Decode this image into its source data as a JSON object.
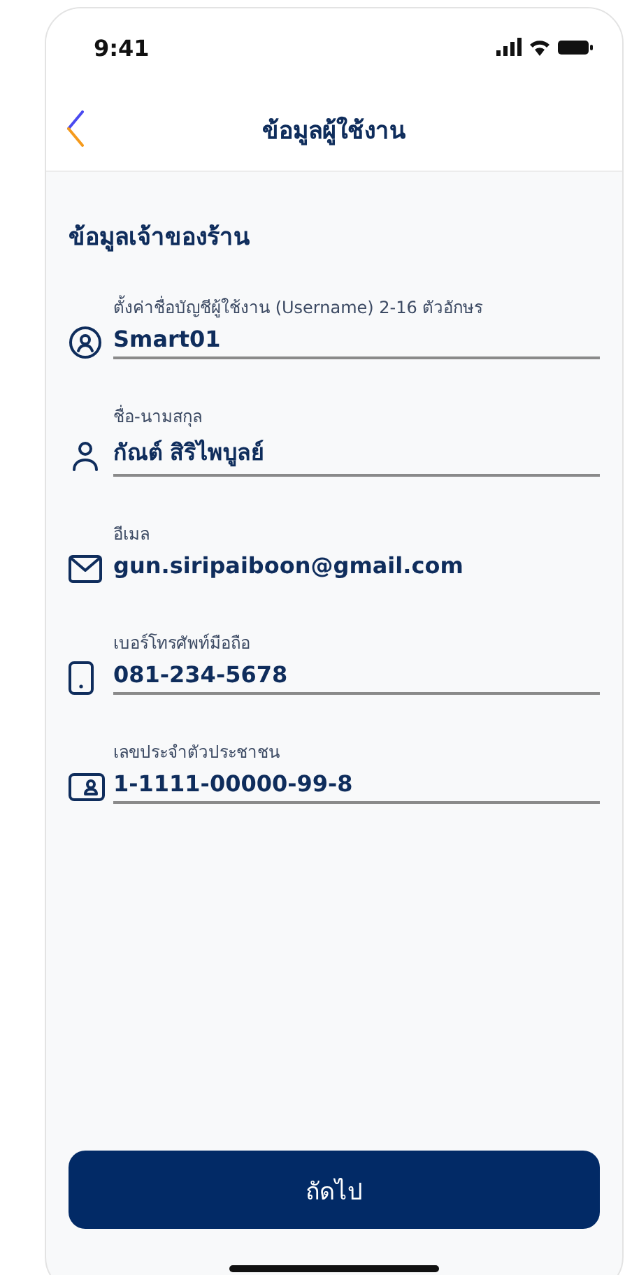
{
  "status_bar": {
    "time": "9:41"
  },
  "nav": {
    "title": "ข้อมูลผู้ใช้งาน"
  },
  "section": {
    "title": "ข้อมูลเจ้าของร้าน"
  },
  "fields": [
    {
      "kind": "username",
      "label": "ตั้งค่าชื่อบัญชีผู้ใช้งาน (Username) 2-16 ตัวอักษร",
      "value": "Smart01",
      "underlined": true
    },
    {
      "kind": "person",
      "label": "ชื่อ-นามสกุล",
      "value": "กัณต์ สิริไพบูลย์",
      "underlined": true
    },
    {
      "kind": "email",
      "label": "อีเมล",
      "value": "gun.siripaiboon@gmail.com",
      "underlined": false
    },
    {
      "kind": "phone",
      "label": "เบอร์โทรศัพท์มือถือ",
      "value": "081-234-5678",
      "underlined": true
    },
    {
      "kind": "idcard",
      "label": "เลขประจำตัวประชาชน",
      "value": "1-1111-00000-99-8",
      "underlined": true
    }
  ],
  "button": {
    "label": "ถัดไป"
  }
}
